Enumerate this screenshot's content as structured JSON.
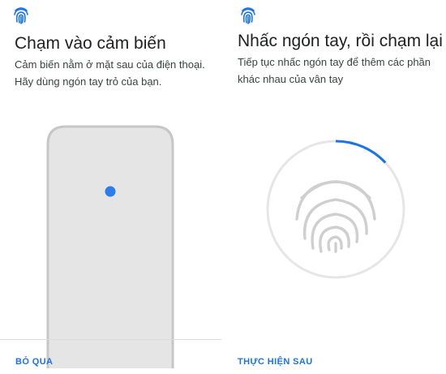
{
  "colors": {
    "accent": "#1a73e8",
    "sensor_dot": "#2b7de9",
    "phone_fill": "#e5e5e5",
    "phone_border": "#c6c6c6",
    "ring_track": "#e6e6e6",
    "fingerprint_stroke": "#cfcfcf"
  },
  "left_screen": {
    "header_icon": "fingerprint-icon",
    "title": "Chạm vào cảm biến",
    "description": "Cảm biến nằm ở mặt sau của điện thoại. Hãy dùng ngón tay trỏ của bạn.",
    "illustration": "phone-back-with-sensor",
    "skip_label": "BỎ QUA"
  },
  "right_screen": {
    "header_icon": "fingerprint-icon",
    "title": "Nhấc ngón tay, rồi chạm lại",
    "description": "Tiếp tục nhấc ngón tay để thêm các phần khác nhau của vân tay",
    "enroll_progress": 0.13,
    "center_icon": "fingerprint-icon",
    "later_label": "THỰC HIỆN SAU"
  }
}
